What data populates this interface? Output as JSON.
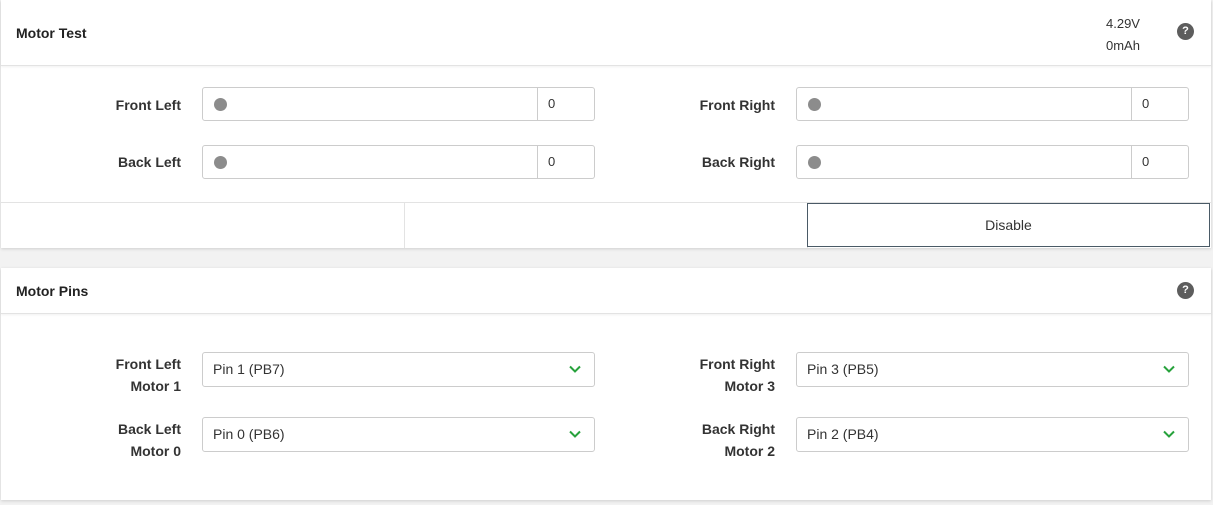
{
  "motor_test": {
    "title": "Motor Test",
    "help_icon": "?",
    "battery": {
      "voltage": "4.29V",
      "capacity": "0mAh"
    },
    "motors": [
      {
        "label": "Front Left",
        "value": "0"
      },
      {
        "label": "Front Right",
        "value": "0"
      },
      {
        "label": "Back Left",
        "value": "0"
      },
      {
        "label": "Back Right",
        "value": "0"
      }
    ],
    "disable_label": "Disable"
  },
  "motor_pins": {
    "title": "Motor Pins",
    "help_icon": "?",
    "pins": [
      {
        "label_line1": "Front Left",
        "label_line2": "Motor 1",
        "selected": "Pin 1 (PB7)"
      },
      {
        "label_line1": "Front Right",
        "label_line2": "Motor 3",
        "selected": "Pin 3 (PB5)"
      },
      {
        "label_line1": "Back Left",
        "label_line2": "Motor 0",
        "selected": "Pin 0 (PB6)"
      },
      {
        "label_line1": "Back Right",
        "label_line2": "Motor 2",
        "selected": "Pin 2 (PB4)"
      }
    ]
  },
  "colors": {
    "accent": "#27a23c",
    "thumb": "#8c8c8c",
    "help": "#5d5d5d"
  },
  "icons": {
    "help": "question-circle-icon",
    "dropdown": "chevron-down-icon",
    "slider": "slider-thumb"
  }
}
